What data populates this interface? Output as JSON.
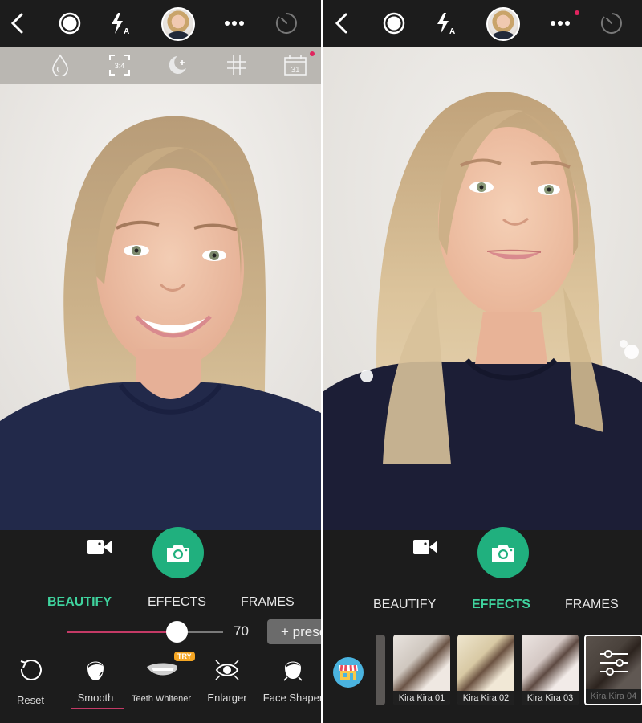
{
  "colors": {
    "accent_green": "#20b07e",
    "active_tab": "#3fd39e",
    "slider_fill": "#c43a66",
    "notification_dot": "#e0245e",
    "try_badge": "#f5a623",
    "background": "#1c1c1c"
  },
  "left_screen": {
    "topbar": {
      "icons": [
        "back-icon",
        "shutter-mode-icon",
        "flash-auto-icon",
        "profile-avatar",
        "more-icon",
        "timer-icon"
      ],
      "flash_label": "A"
    },
    "secondary_toolbar": {
      "icons": [
        "droplet-icon",
        "aspect-ratio-icon",
        "night-mode-icon",
        "grid-icon",
        "calendar-icon"
      ],
      "aspect_label": "3:4",
      "calendar_label": "31",
      "calendar_has_notification": true
    },
    "tabs": [
      {
        "label": "BEAUTIFY",
        "active": true
      },
      {
        "label": "EFFECTS",
        "active": false
      },
      {
        "label": "FRAMES",
        "active": false
      }
    ],
    "slider": {
      "value": 70,
      "display": "70",
      "min": 0,
      "max": 100
    },
    "preset_button": "+ preset",
    "tools": [
      {
        "label": "Reset",
        "icon": "reset-icon"
      },
      {
        "label": "Smooth",
        "icon": "smooth-face-icon",
        "selected": true
      },
      {
        "label": "Teeth Whitener",
        "icon": "teeth-icon",
        "badge": "TRY"
      },
      {
        "label": "Enlarger",
        "icon": "eye-enlarger-icon"
      },
      {
        "label": "Face Shaper",
        "icon": "face-shaper-icon"
      }
    ]
  },
  "right_screen": {
    "topbar": {
      "icons": [
        "back-icon",
        "shutter-mode-icon",
        "flash-auto-icon",
        "profile-avatar",
        "more-icon",
        "timer-icon"
      ],
      "flash_label": "A",
      "more_has_notification": true
    },
    "tabs": [
      {
        "label": "BEAUTIFY",
        "active": false
      },
      {
        "label": "EFFECTS",
        "active": true
      },
      {
        "label": "FRAMES",
        "active": false
      }
    ],
    "effects": [
      {
        "label": "Kira Kira 01",
        "selected": false
      },
      {
        "label": "Kira Kira 02",
        "selected": false
      },
      {
        "label": "Kira Kira 03",
        "selected": false
      },
      {
        "label": "Kira Kira 04",
        "selected": true
      }
    ]
  }
}
